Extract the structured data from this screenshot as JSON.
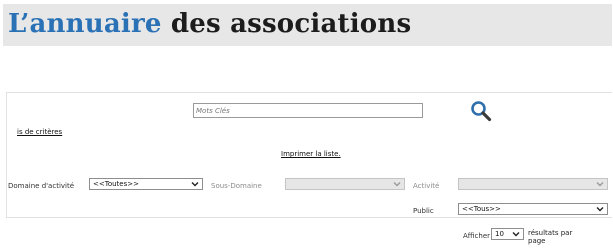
{
  "header": {
    "title_accent": "L’annuaire",
    "title_rest": " des associations"
  },
  "search": {
    "placeholder": "Mots Clés",
    "button_icon": "search-icon"
  },
  "links": {
    "criteria": "is de critères",
    "print": "Imprimer la liste."
  },
  "filters": {
    "domain_label": "Domaine d'activité",
    "domain_value": "<<Toutes>>",
    "subdomain_label": "Sous-Domaine",
    "subdomain_value": "",
    "activity_label": "Activité",
    "activity_value": "",
    "public_label": "Public",
    "public_value": "<<Tous>>"
  },
  "pagination": {
    "show_label": "Afficher",
    "per_page_value": "10",
    "results_label": "résultats par page"
  },
  "colors": {
    "accent": "#2a72b5",
    "banner_bg": "#e7e7e7",
    "search_icon": "#2f6fad"
  }
}
